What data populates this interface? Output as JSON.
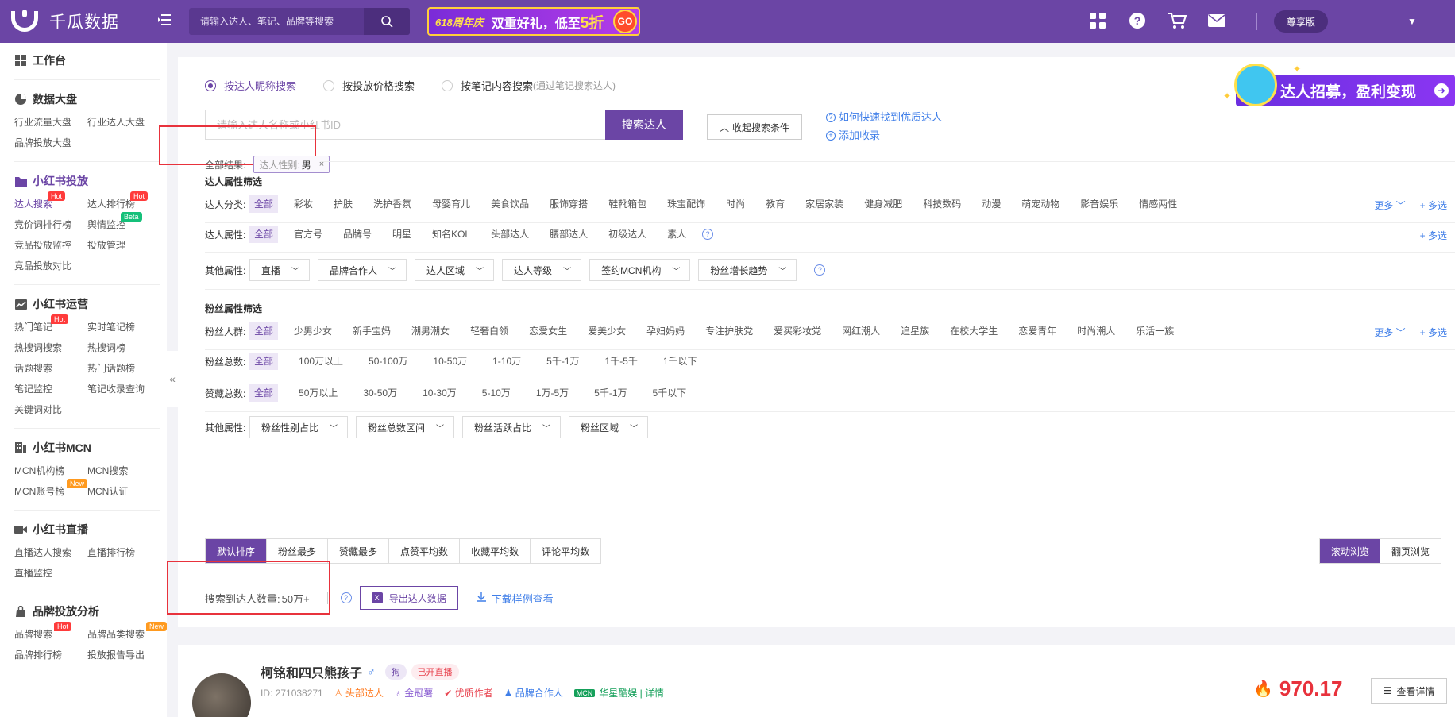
{
  "header": {
    "brand": "千瓜数据",
    "search_placeholder": "请输入达人、笔记、品牌等搜索",
    "promo_tag": "618周年庆",
    "promo_text_prefix": "双重好礼，低至",
    "promo_text_highlight": "5折",
    "promo_go": "GO",
    "vip_label": "尊享版",
    "icons": [
      "apps-icon",
      "help-icon",
      "cart-icon",
      "mail-icon"
    ]
  },
  "sidebar": {
    "workbench": "工作台",
    "sections": [
      {
        "title": "数据大盘",
        "icon": "pie-icon",
        "items": [
          {
            "label": "行业流量大盘"
          },
          {
            "label": "行业达人大盘"
          },
          {
            "label": "品牌投放大盘"
          }
        ]
      },
      {
        "title": "小红书投放",
        "icon": "folder-icon",
        "active": true,
        "items": [
          {
            "label": "达人搜索",
            "badge": "Hot",
            "selected": true
          },
          {
            "label": "达人排行榜",
            "badge": "Hot"
          },
          {
            "label": "竞价词排行榜"
          },
          {
            "label": "舆情监控",
            "badge": "Beta"
          },
          {
            "label": "竞品投放监控"
          },
          {
            "label": "投放管理"
          },
          {
            "label": "竞品投放对比"
          }
        ]
      },
      {
        "title": "小红书运营",
        "icon": "chart-icon",
        "items": [
          {
            "label": "热门笔记",
            "badge": "Hot"
          },
          {
            "label": "实时笔记榜"
          },
          {
            "label": "热搜词搜索"
          },
          {
            "label": "热搜词榜"
          },
          {
            "label": "话题搜索"
          },
          {
            "label": "热门话题榜"
          },
          {
            "label": "笔记监控"
          },
          {
            "label": "笔记收录查询"
          },
          {
            "label": "关键词对比"
          }
        ]
      },
      {
        "title": "小红书MCN",
        "icon": "building-icon",
        "items": [
          {
            "label": "MCN机构榜"
          },
          {
            "label": "MCN搜索"
          },
          {
            "label": "MCN账号榜",
            "badge": "New"
          },
          {
            "label": "MCN认证"
          }
        ]
      },
      {
        "title": "小红书直播",
        "icon": "video-icon",
        "items": [
          {
            "label": "直播达人搜索"
          },
          {
            "label": "直播排行榜"
          },
          {
            "label": "直播监控"
          }
        ]
      },
      {
        "title": "品牌投放分析",
        "icon": "bag-icon",
        "items": [
          {
            "label": "品牌搜索",
            "badge": "Hot"
          },
          {
            "label": "品牌品类搜索",
            "badge": "New"
          },
          {
            "label": "品牌排行榜"
          },
          {
            "label": "投放报告导出"
          }
        ]
      }
    ]
  },
  "search_modes": [
    {
      "label": "按达人昵称搜索",
      "selected": true,
      "hint": ""
    },
    {
      "label": "按投放价格搜索",
      "selected": false,
      "hint": ""
    },
    {
      "label": "按笔记内容搜索",
      "selected": false,
      "hint": "(通过笔记搜索达人)"
    }
  ],
  "search": {
    "placeholder": "请输入达人名称或小红书ID",
    "button": "搜索达人",
    "fold_button": "收起搜索条件",
    "help_link": "如何快速找到优质达人",
    "add_link": "添加收录"
  },
  "promo_banner": {
    "text": "达人招募，盈利变现"
  },
  "results": {
    "label": "全部结果:",
    "chip_key": "达人性别:",
    "chip_value": "男"
  },
  "filters": {
    "creator_title": "达人属性筛选",
    "category_label": "达人分类:",
    "categories": [
      "全部",
      "彩妆",
      "护肤",
      "洗护香氛",
      "母婴育儿",
      "美食饮品",
      "服饰穿搭",
      "鞋靴箱包",
      "珠宝配饰",
      "时尚",
      "教育",
      "家居家装",
      "健身减肥",
      "科技数码",
      "动漫",
      "萌宠动物",
      "影音娱乐",
      "情感两性"
    ],
    "attr_label": "达人属性:",
    "attrs": [
      "全部",
      "官方号",
      "品牌号",
      "明星",
      "知名KOL",
      "头部达人",
      "腰部达人",
      "初级达人",
      "素人"
    ],
    "other_label": "其他属性:",
    "other_dropdowns": [
      "直播",
      "品牌合作人",
      "达人区域",
      "达人等级",
      "签约MCN机构",
      "粉丝增长趋势"
    ],
    "fans_title": "粉丝属性筛选",
    "crowd_label": "粉丝人群:",
    "crowds": [
      "全部",
      "少男少女",
      "新手宝妈",
      "潮男潮女",
      "轻奢白领",
      "恋爱女生",
      "爱美少女",
      "孕妇妈妈",
      "专注护肤党",
      "爱买彩妆党",
      "网红潮人",
      "追星族",
      "在校大学生",
      "恋爱青年",
      "时尚潮人",
      "乐活一族"
    ],
    "fans_total_label": "粉丝总数:",
    "fans_totals": [
      "全部",
      "100万以上",
      "50-100万",
      "10-50万",
      "1-10万",
      "5千-1万",
      "1千-5千",
      "1千以下"
    ],
    "likes_label": "赞藏总数:",
    "likes_totals": [
      "全部",
      "50万以上",
      "30-50万",
      "10-30万",
      "5-10万",
      "1万-5万",
      "5千-1万",
      "5千以下"
    ],
    "fans_other_label": "其他属性:",
    "fans_other_dropdowns": [
      "粉丝性别占比",
      "粉丝总数区间",
      "粉丝活跃占比",
      "粉丝区域"
    ],
    "more": "更多",
    "multi": "+ 多选"
  },
  "sort": {
    "options": [
      "默认排序",
      "粉丝最多",
      "赞藏最多",
      "点赞平均数",
      "收藏平均数",
      "评论平均数"
    ],
    "views": [
      "滚动浏览",
      "翻页浏览"
    ]
  },
  "count": {
    "label": "搜索到达人数量:",
    "value": "50万+",
    "export": "导出达人数据",
    "download": "下载样例查看"
  },
  "card": {
    "name": "柯铭和四只熊孩子",
    "tag": "狗",
    "live": "已开直播",
    "id": "ID: 271038271",
    "meta1": "头部达人",
    "meta2": "金冠薯",
    "meta3": "优质作者",
    "meta4": "品牌合作人",
    "mcn_tag": "MCN",
    "mcn": "华星酷娱 | 详情",
    "score": "970.17",
    "detail": "查看详情"
  }
}
